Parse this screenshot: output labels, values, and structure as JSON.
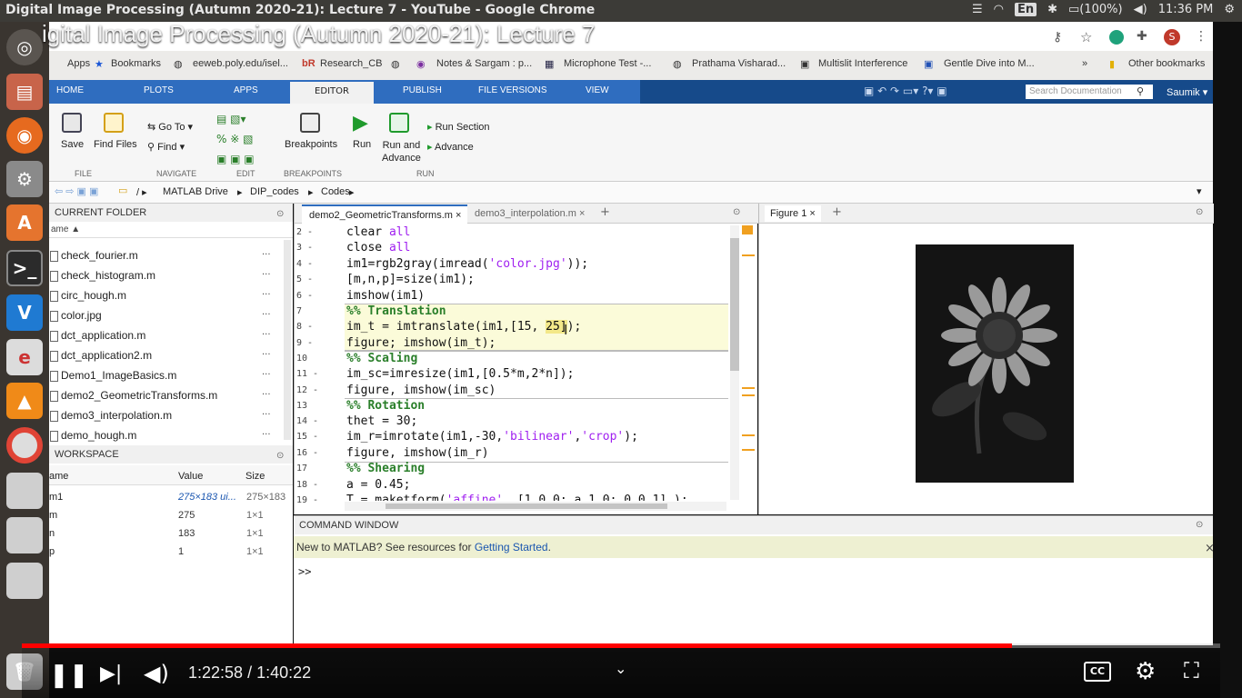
{
  "os": {
    "window_title": "Digital Image Processing (Autumn 2020-21): Lecture 7 - YouTube - Google Chrome",
    "keyboard": "En",
    "battery": "(100%)",
    "clock": "11:36 PM"
  },
  "video": {
    "title": "igital Image Processing (Autumn 2020-21): Lecture 7",
    "time_current": "1:22:58",
    "time_separator": "/",
    "time_total": "1:40:22",
    "progress": 0.8265
  },
  "bookmarks": {
    "items": [
      "Apps",
      "Bookmarks",
      "eeweb.poly.edu/isel...",
      "Research_CB",
      "Notes & Sargam : p...",
      "Microphone Test -...",
      "Prathama Visharad...",
      "Multislit Interference",
      "Gentle Dive into M..."
    ],
    "other": "Other bookmarks"
  },
  "matlab": {
    "tabs": [
      "HOME",
      "PLOTS",
      "APPS",
      "EDITOR",
      "PUBLISH",
      "FILE VERSIONS",
      "VIEW"
    ],
    "search_placeholder": "Search Documentation",
    "user": "Saumik",
    "ribbon": {
      "save": "Save",
      "find_files": "Find Files",
      "go_to": "Go To",
      "find": "Find",
      "breakpoints": "Breakpoints",
      "run": "Run",
      "run_and": "Run and",
      "advance_label": "Advance",
      "run_section": "Run Section",
      "advance": "Advance",
      "sections": [
        "FILE",
        "NAVIGATE",
        "EDIT",
        "BREAKPOINTS",
        "RUN"
      ]
    },
    "path": [
      "MATLAB Drive",
      "DIP_codes",
      "Codes"
    ],
    "current_folder": {
      "title": "CURRENT FOLDER",
      "col_header": "ame",
      "files": [
        "check_fourier.m",
        "check_histogram.m",
        "circ_hough.m",
        "color.jpg",
        "dct_application.m",
        "dct_application2.m",
        "Demo1_ImageBasics.m",
        "demo2_GeometricTransforms.m",
        "demo3_interpolation.m",
        "demo_hough.m"
      ]
    },
    "workspace": {
      "title": "WORKSPACE",
      "headers": [
        "ame",
        "Value",
        "Size"
      ],
      "rows": [
        {
          "name": "m1",
          "value": "275×183 ui...",
          "size": "275×183"
        },
        {
          "name": "m",
          "value": "275",
          "size": "1×1"
        },
        {
          "name": "n",
          "value": "183",
          "size": "1×1"
        },
        {
          "name": "p",
          "value": "1",
          "size": "1×1"
        }
      ]
    },
    "editor": {
      "tabs": [
        "demo2_GeometricTransforms.m",
        "demo3_interpolation.m"
      ],
      "line_numbers": [
        "2",
        "3",
        "4",
        "5",
        "6",
        "7",
        "8",
        "9",
        "10",
        "11",
        "12",
        "13",
        "14",
        "15",
        "16",
        "17",
        "18",
        "19"
      ],
      "markers": [
        "-",
        "-",
        "-",
        "-",
        "-",
        "",
        "-",
        "-",
        "",
        "-",
        "-",
        "",
        "-",
        "-",
        "-",
        "",
        "-",
        "-"
      ]
    },
    "figure": {
      "tab": "Figure 1"
    },
    "command": {
      "title": "COMMAND WINDOW",
      "notice": "New to MATLAB? See resources for",
      "notice_link": "Getting Started",
      "notice_end": ".",
      "prompt": ">>"
    }
  }
}
